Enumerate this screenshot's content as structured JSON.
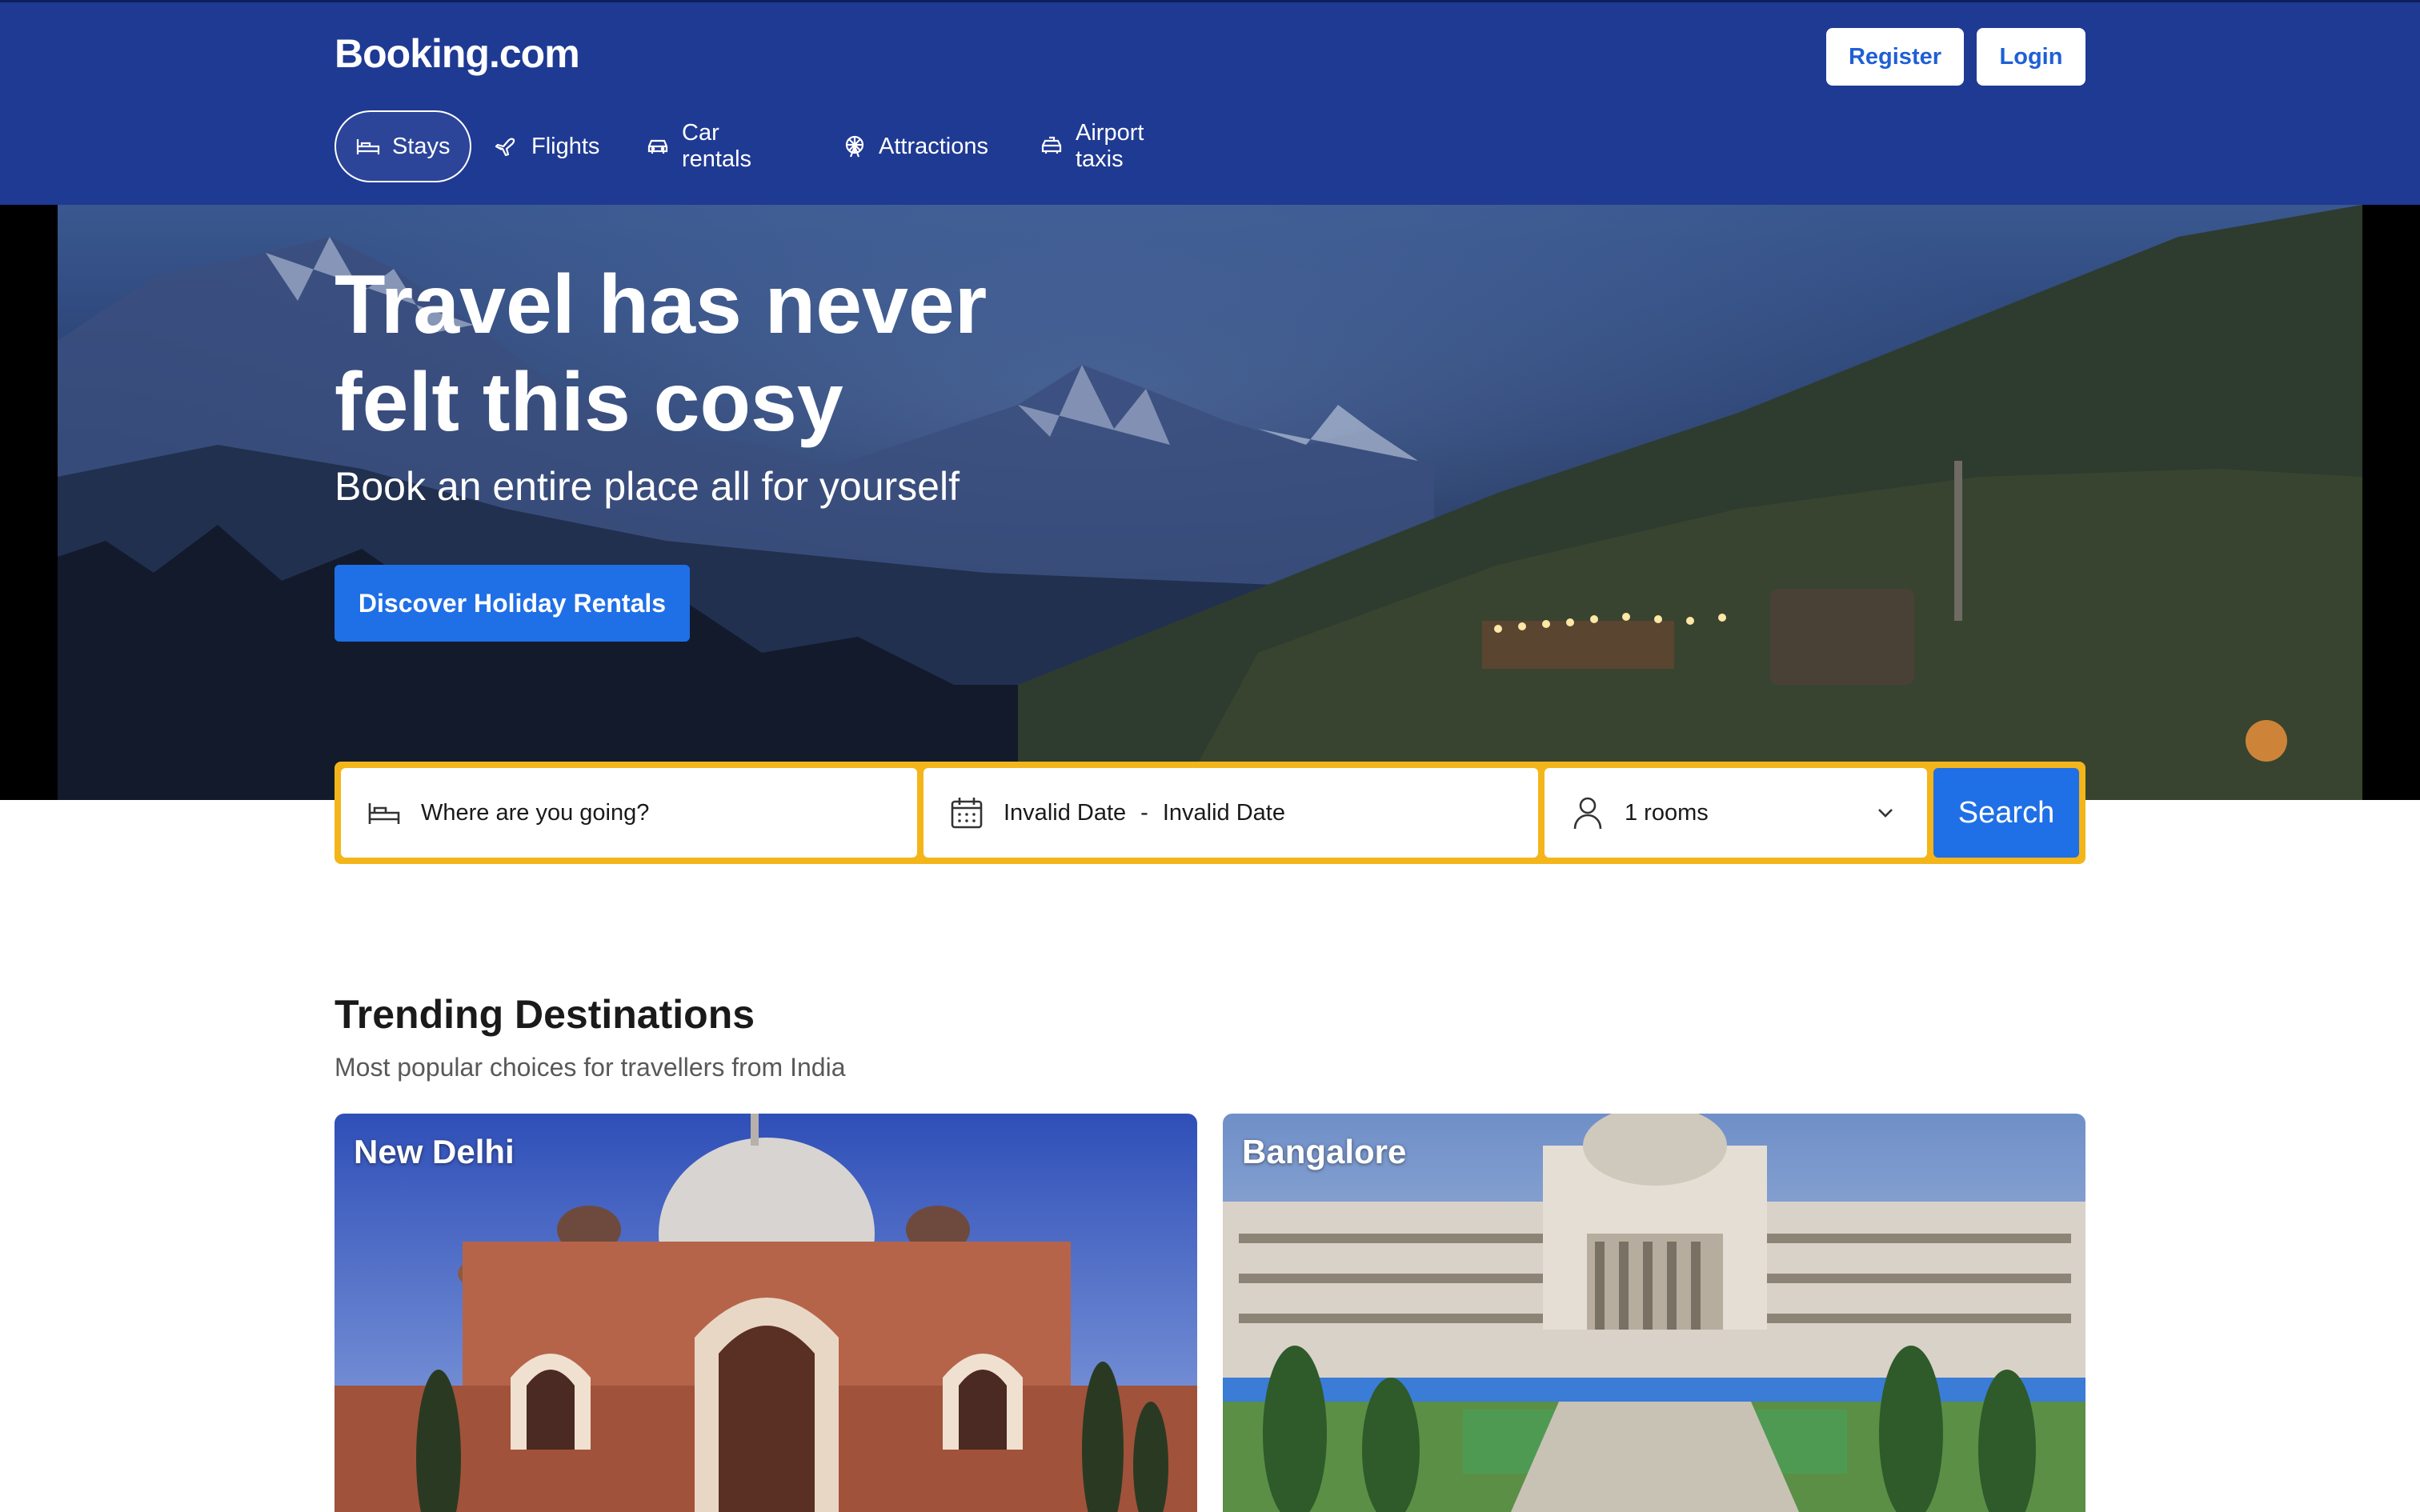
{
  "header": {
    "logo": "Booking.com",
    "register_label": "Register",
    "login_label": "Login",
    "nav": [
      {
        "label": "Stays",
        "icon": "bed-icon",
        "active": true
      },
      {
        "label": "Flights",
        "icon": "plane-icon",
        "active": false
      },
      {
        "label": "Car rentals",
        "icon": "car-icon",
        "active": false
      },
      {
        "label": "Attractions",
        "icon": "ferris-wheel-icon",
        "active": false
      },
      {
        "label": "Airport taxis",
        "icon": "taxi-icon",
        "active": false
      }
    ]
  },
  "hero": {
    "title_line1": "Travel has never",
    "title_line2": "felt this cosy",
    "subtitle": "Book an entire place all for yourself",
    "cta_label": "Discover Holiday Rentals"
  },
  "search": {
    "destination_placeholder": "Where are you going?",
    "check_in": "Invalid Date",
    "date_separator": "-",
    "check_out": "Invalid Date",
    "rooms": "1 rooms",
    "button_label": "Search"
  },
  "trending": {
    "title": "Trending Destinations",
    "subtitle": "Most popular choices for travellers from India",
    "destinations": [
      {
        "name": "New Delhi"
      },
      {
        "name": "Bangalore"
      }
    ]
  },
  "colors": {
    "header_bg": "#1f3a93",
    "primary_button": "#1f6fe6",
    "search_border": "#f3b51a"
  }
}
